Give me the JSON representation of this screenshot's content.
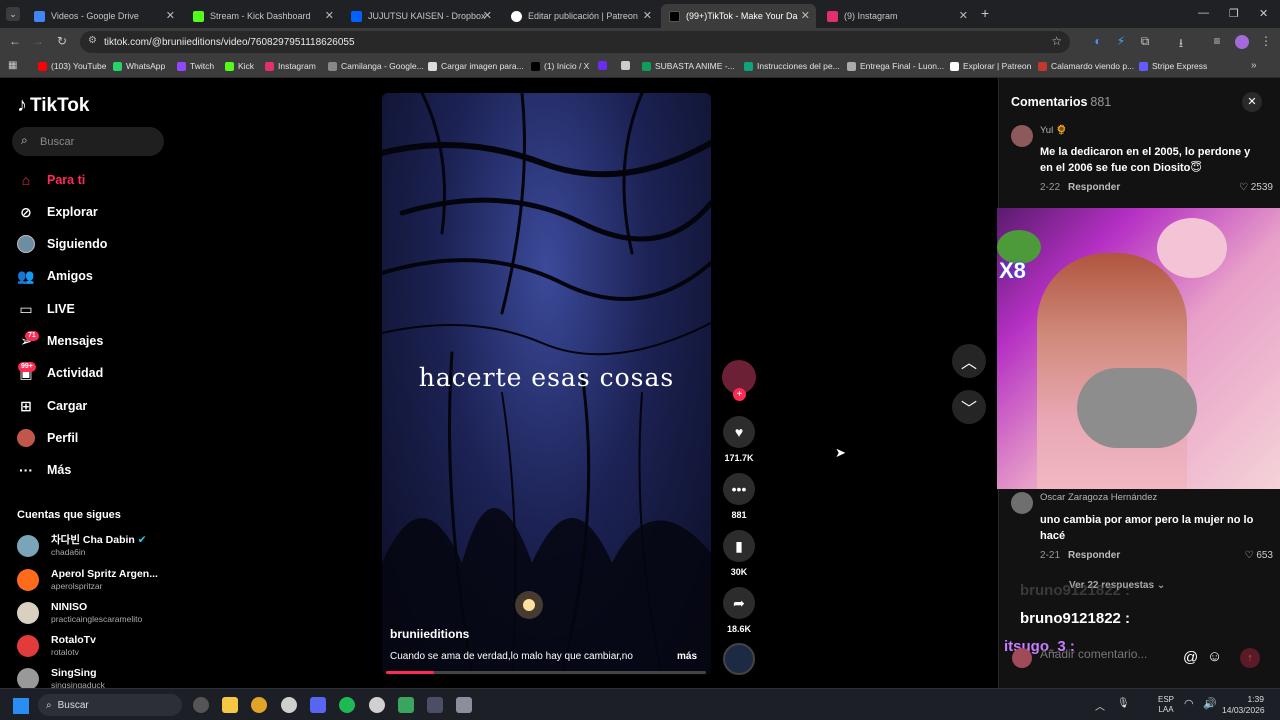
{
  "browser": {
    "tabs": [
      {
        "label": "Videos - Google Drive",
        "color": "#4285f4"
      },
      {
        "label": "Stream - Kick Dashboard",
        "color": "#53fc18"
      },
      {
        "label": "JUJUTSU KAISEN - Dropbox",
        "color": "#0061fe"
      },
      {
        "label": "Editar publicación | Patreon",
        "color": "#ffffff"
      },
      {
        "label": "(99+)TikTok - Make Your Da",
        "color": "#000000"
      },
      {
        "label": "(9) Instagram",
        "color": "#e1306c"
      }
    ],
    "new_tab": "+",
    "url": "tiktok.com/@bruniieditions/video/7608297951118626055",
    "bookmarks": [
      {
        "label": "(103) YouTube",
        "color": "#ff0000"
      },
      {
        "label": "WhatsApp",
        "color": "#25d366"
      },
      {
        "label": "Twitch",
        "color": "#9146ff"
      },
      {
        "label": "Kick",
        "color": "#53fc18"
      },
      {
        "label": "Instagram",
        "color": "#e1306c"
      },
      {
        "label": "Camilanga - Google...",
        "color": "#888888"
      },
      {
        "label": "Cargar imagen para...",
        "color": "#dddddd"
      },
      {
        "label": "(1) Inicio / X",
        "color": "#000000"
      },
      {
        "label": "",
        "color": "#6a2cf2"
      },
      {
        "label": "",
        "color": "#cccccc"
      },
      {
        "label": "SUBASTA ANIME -...",
        "color": "#0f9d58"
      },
      {
        "label": "Instrucciones del pe...",
        "color": "#10a37f"
      },
      {
        "label": "Entrega Final - Luon...",
        "color": "#aaaaaa"
      },
      {
        "label": "Explorar | Patreon",
        "color": "#ffffff"
      },
      {
        "label": "Calamardo viendo p...",
        "color": "#c0392b"
      },
      {
        "label": "Stripe Express",
        "color": "#635bff"
      }
    ]
  },
  "tiktok": {
    "logo": "TikTok",
    "search_placeholder": "Buscar",
    "nav": [
      {
        "label": "Para ti",
        "icon": "home-icon",
        "active": true
      },
      {
        "label": "Explorar",
        "icon": "compass-icon"
      },
      {
        "label": "Siguiendo",
        "icon": "following-avatar-icon"
      },
      {
        "label": "Amigos",
        "icon": "friends-icon"
      },
      {
        "label": "LIVE",
        "icon": "live-icon"
      },
      {
        "label": "Mensajes",
        "icon": "paper-plane-icon",
        "badge": "71"
      },
      {
        "label": "Actividad",
        "icon": "inbox-icon",
        "badge": "99+"
      },
      {
        "label": "Cargar",
        "icon": "upload-icon"
      },
      {
        "label": "Perfil",
        "icon": "profile-avatar-icon"
      },
      {
        "label": "Más",
        "icon": "more-icon"
      }
    ],
    "following_title": "Cuentas que sigues",
    "following": [
      {
        "name": "차다빈 Cha Dabin",
        "handle": "chada6in",
        "verified": true,
        "color": "#7aa4b8"
      },
      {
        "name": "Aperol Spritz Argen...",
        "handle": "aperolspritzar",
        "color": "#ff6b1a"
      },
      {
        "name": "NINISO",
        "handle": "practicainglescaramelito",
        "color": "#d9d0c0"
      },
      {
        "name": "RotaloTv",
        "handle": "rotalotv",
        "color": "#e23b3b"
      },
      {
        "name": "SingSing",
        "handle": "singsingaduck",
        "color": "#999999"
      }
    ]
  },
  "video": {
    "overlay_text": "hacerte esas cosas",
    "author": "bruniieditions",
    "description": "Cuando se ama de verdad,lo malo hay que cambiar,no",
    "more_label": "más",
    "progress": 0.15,
    "actions": {
      "likes": "171.7K",
      "comments": "881",
      "saves": "30K",
      "shares": "18.6K"
    }
  },
  "comments_panel": {
    "title": "Comentarios",
    "count": "881",
    "close": "✕",
    "comments": [
      {
        "user": "Yul 🌻",
        "text": "Me la dedicaron en el 2005, lo perdone y en el 2006 se fue con Diosito😇",
        "date": "2-22",
        "reply": "Responder",
        "likes": "2539"
      },
      {
        "user": "Oscar Zaragoza Hernández",
        "text": "uno cambia por amor pero la mujer no lo hacé",
        "date": "2-21",
        "reply": "Responder",
        "likes": "653"
      }
    ],
    "view_replies": "Ver 22 respuestas",
    "input_placeholder": "Añadir comentario..."
  },
  "stream_overlay": {
    "multiplier": "X8",
    "chat": [
      {
        "user": "bruno9121822 :",
        "color": "#ffffff"
      },
      {
        "user": "itsugo_3 :",
        "color": "#c77dff"
      }
    ]
  },
  "taskbar": {
    "search": "Buscar",
    "lang": "ESP",
    "lang_sub": "LAA",
    "time": "1:39",
    "date": "14/03/2026"
  }
}
